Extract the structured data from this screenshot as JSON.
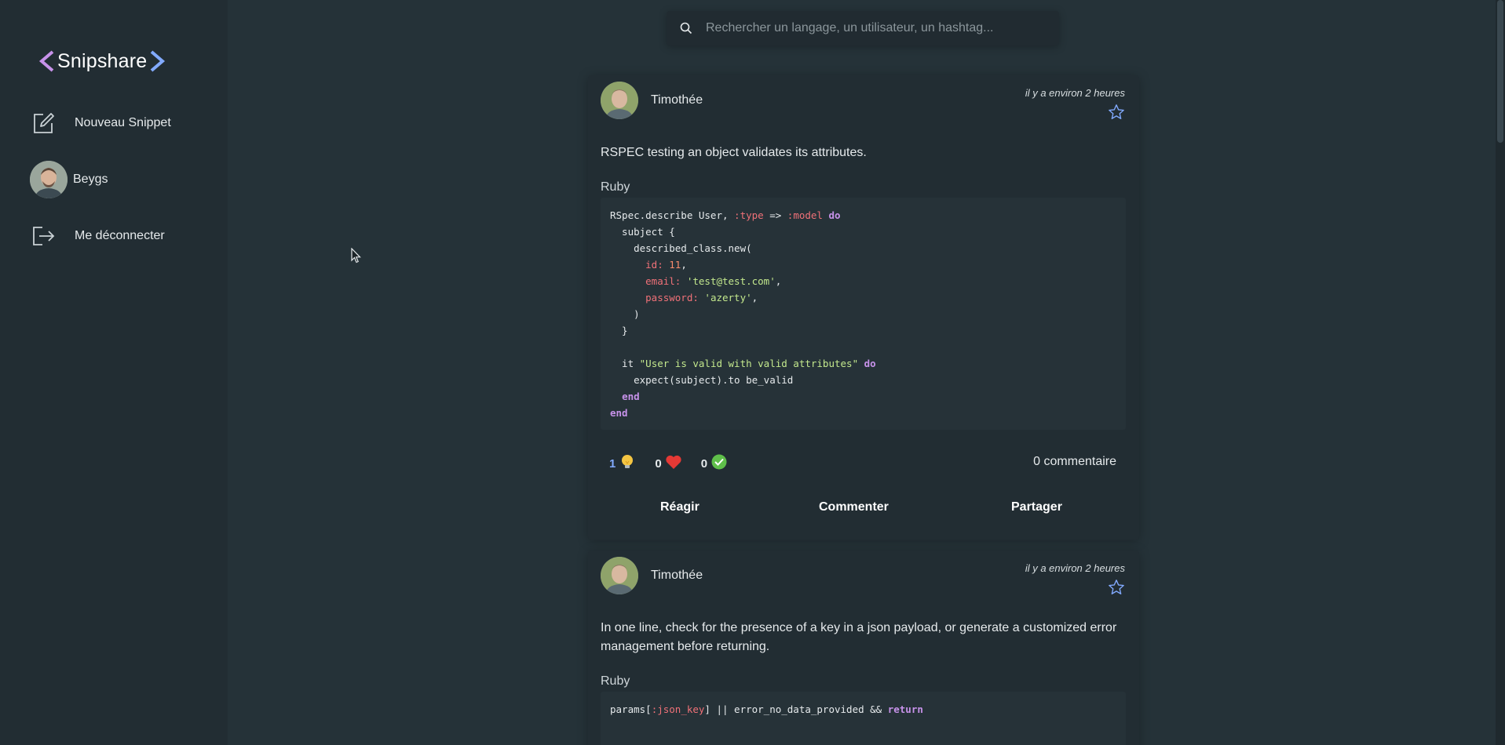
{
  "app": {
    "logo_text": "Snipshare",
    "accent_left": "#c792ea",
    "accent_right": "#82aaff"
  },
  "sidebar": {
    "items": [
      {
        "label": "Nouveau Snippet",
        "icon": "edit-icon"
      },
      {
        "label": "Beygs",
        "icon": "avatar"
      },
      {
        "label": "Me déconnecter",
        "icon": "logout-icon"
      }
    ]
  },
  "search": {
    "placeholder": "Rechercher un langage, un utilisateur, un hashtag..."
  },
  "posts": [
    {
      "author": "Timothée",
      "time": "il y a environ 2 heures",
      "description": "RSPEC testing an object validates its attributes.",
      "language": "Ruby",
      "code": [
        {
          "t": "RSpec.describe User, "
        },
        {
          "t": ":type",
          "c": "sym"
        },
        {
          "t": " => "
        },
        {
          "t": ":model",
          "c": "sym"
        },
        {
          "t": " "
        },
        {
          "t": "do",
          "c": "kw"
        },
        {
          "t": "\n  subject {\n    described_class.new(\n      "
        },
        {
          "t": "id:",
          "c": "sym"
        },
        {
          "t": " "
        },
        {
          "t": "11",
          "c": "num"
        },
        {
          "t": ",\n      "
        },
        {
          "t": "email:",
          "c": "sym"
        },
        {
          "t": " "
        },
        {
          "t": "'test@test.com'",
          "c": "str"
        },
        {
          "t": ",\n      "
        },
        {
          "t": "password:",
          "c": "sym"
        },
        {
          "t": " "
        },
        {
          "t": "'azerty'",
          "c": "str"
        },
        {
          "t": ",\n    )\n  }\n\n  it "
        },
        {
          "t": "\"User is valid with valid attributes\"",
          "c": "str"
        },
        {
          "t": " "
        },
        {
          "t": "do",
          "c": "kw"
        },
        {
          "t": "\n    expect(subject).to be_valid\n  "
        },
        {
          "t": "end",
          "c": "kw"
        },
        {
          "t": "\n"
        },
        {
          "t": "end",
          "c": "kw"
        }
      ],
      "reactions": [
        {
          "count": "1",
          "icon": "lightbulb-icon",
          "active": true
        },
        {
          "count": "0",
          "icon": "heart-icon",
          "active": false
        },
        {
          "count": "0",
          "icon": "check-icon",
          "active": false
        }
      ],
      "comments": "0 commentaire",
      "actions": [
        "Réagir",
        "Commenter",
        "Partager"
      ]
    },
    {
      "author": "Timothée",
      "time": "il y a environ 2 heures",
      "description": "In one line, check for the presence of a key in a json payload, or generate a customized error management before returning.",
      "language": "Ruby",
      "code": [
        {
          "t": "params["
        },
        {
          "t": ":json_key",
          "c": "sym"
        },
        {
          "t": "] || error_no_data_provided && "
        },
        {
          "t": "return",
          "c": "kw"
        }
      ]
    }
  ]
}
